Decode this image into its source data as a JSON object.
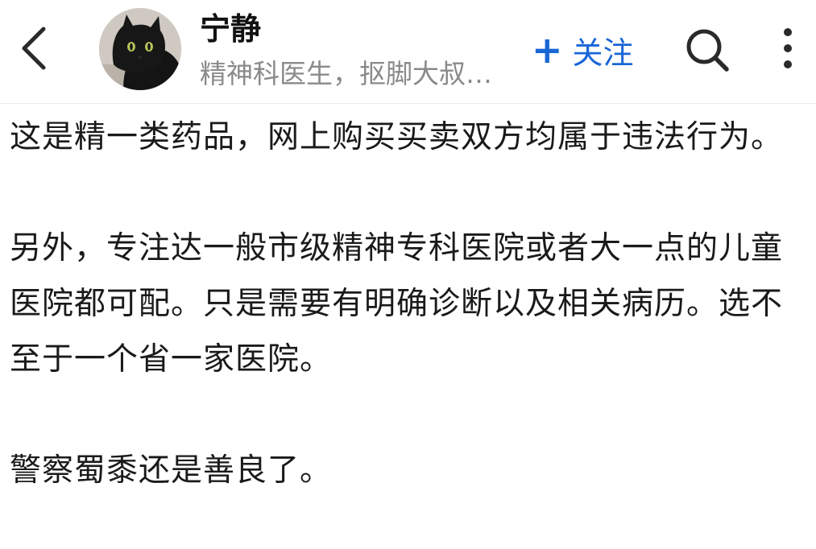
{
  "header": {
    "back_icon": "chevron-left-icon",
    "author_name": "宁静",
    "author_bio": "精神科医生，抠脚大叔…",
    "follow_plus": "+",
    "follow_label": "关注",
    "search_icon": "search-icon",
    "more_icon": "more-vertical-icon",
    "accent_color": "#1a66d6"
  },
  "content": {
    "paragraphs": [
      "这是精一类药品，网上购买买卖双方均属于违法行为。",
      "另外，专注达一般市级精神专科医院或者大一点的儿童医院都可配。只是需要有明确诊断以及相关病历。选不至于一个省一家医院。",
      "警察蜀黍还是善良了。"
    ]
  }
}
